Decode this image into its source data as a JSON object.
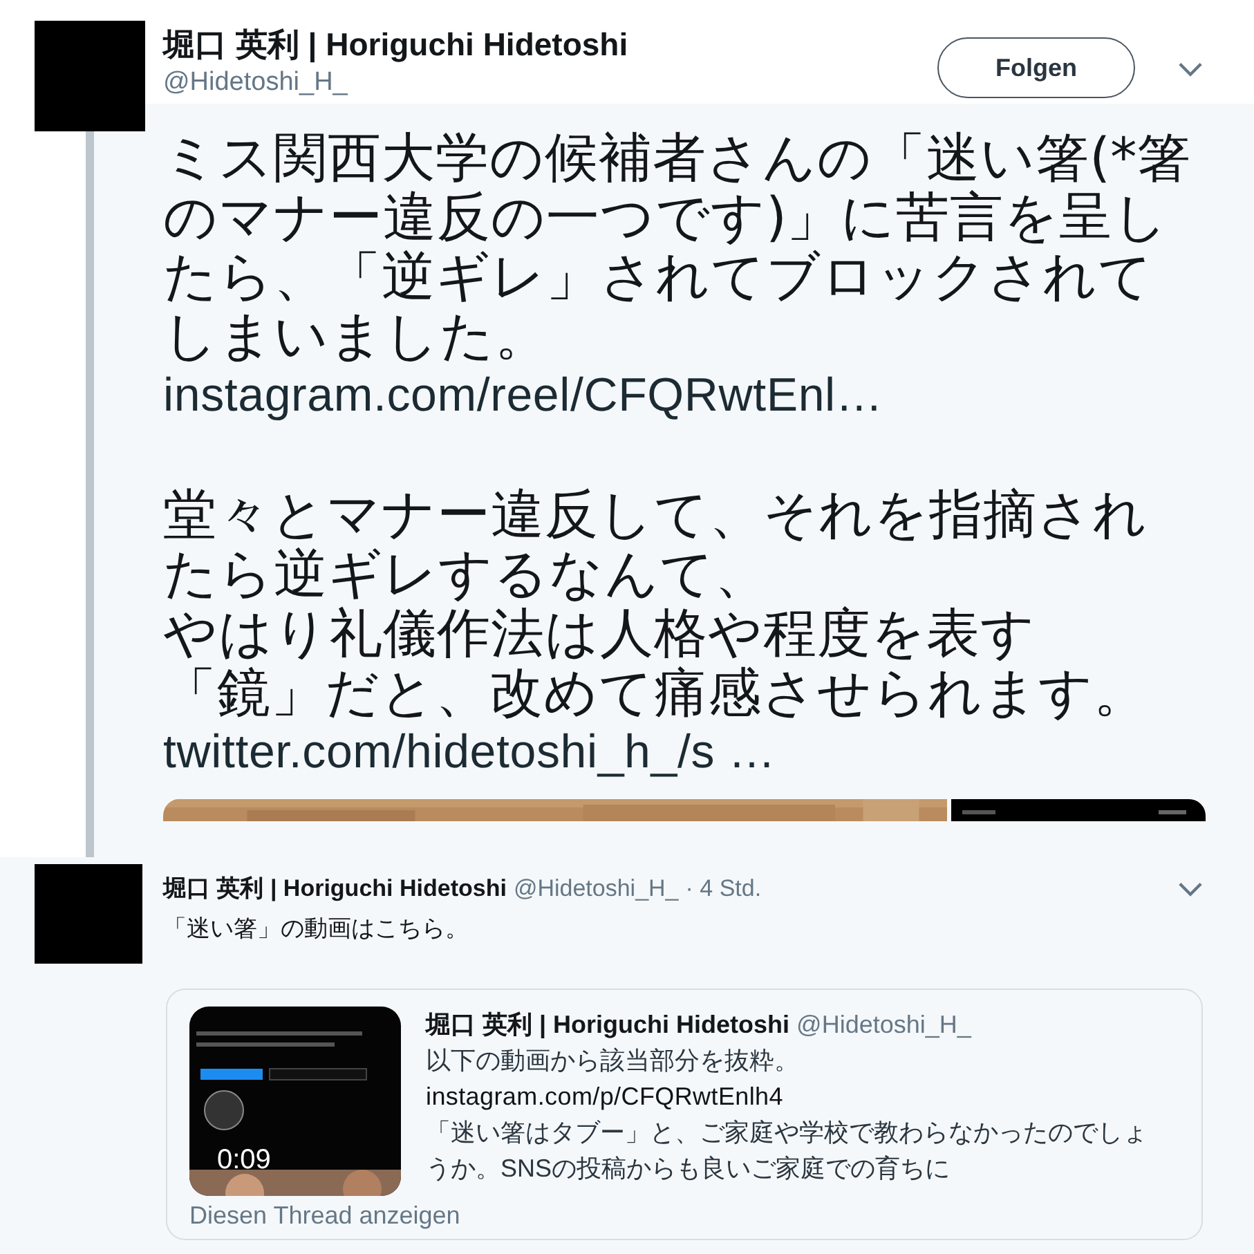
{
  "tweet": {
    "author": "堀口 英利 | Horiguchi Hidetoshi",
    "handle": "@Hidetoshi_H_",
    "follow_button": "Folgen",
    "paragraphs": [
      {
        "kind": "text",
        "text": "ミス関西大学の候補者さんの「迷い箸(*箸のマナー違反の一つです)」に苦言を呈したら、「逆ギレ」されてブロックされてしまいました。"
      },
      {
        "kind": "link",
        "text": "instagram.com/reel/CFQRwtEnl…"
      },
      {
        "kind": "gap"
      },
      {
        "kind": "text",
        "text": "堂々とマナー違反して、それを指摘されたら逆ギレするなんて、"
      },
      {
        "kind": "text",
        "text": "やはり礼儀作法は人格や程度を表す"
      },
      {
        "kind": "text",
        "text": "「鏡」だと、改めて痛感させられます。"
      },
      {
        "kind": "link",
        "text": "twitter.com/hidetoshi_h_/s …"
      }
    ]
  },
  "reply": {
    "author": "堀口 英利 | Horiguchi Hidetoshi",
    "handle": "@Hidetoshi_H_",
    "time": "· 4 Std.",
    "text": "「迷い箸」の動画はこちら。",
    "quote": {
      "author": "堀口 英利 | Horiguchi Hidetoshi",
      "handle": "@Hidetoshi_H_",
      "duration": "0:09",
      "lines": [
        {
          "kind": "text",
          "text": "以下の動画から該当部分を抜粋。"
        },
        {
          "kind": "link",
          "text": "instagram.com/p/CFQRwtEnlh4"
        },
        {
          "kind": "text",
          "text": "「迷い箸はタブー」と、ご家庭や学校で教わらなかったのでしょうか。SNSの投稿からも良いご家庭での育ちに"
        }
      ]
    },
    "thread_link": "Diesen Thread anzeigen"
  }
}
